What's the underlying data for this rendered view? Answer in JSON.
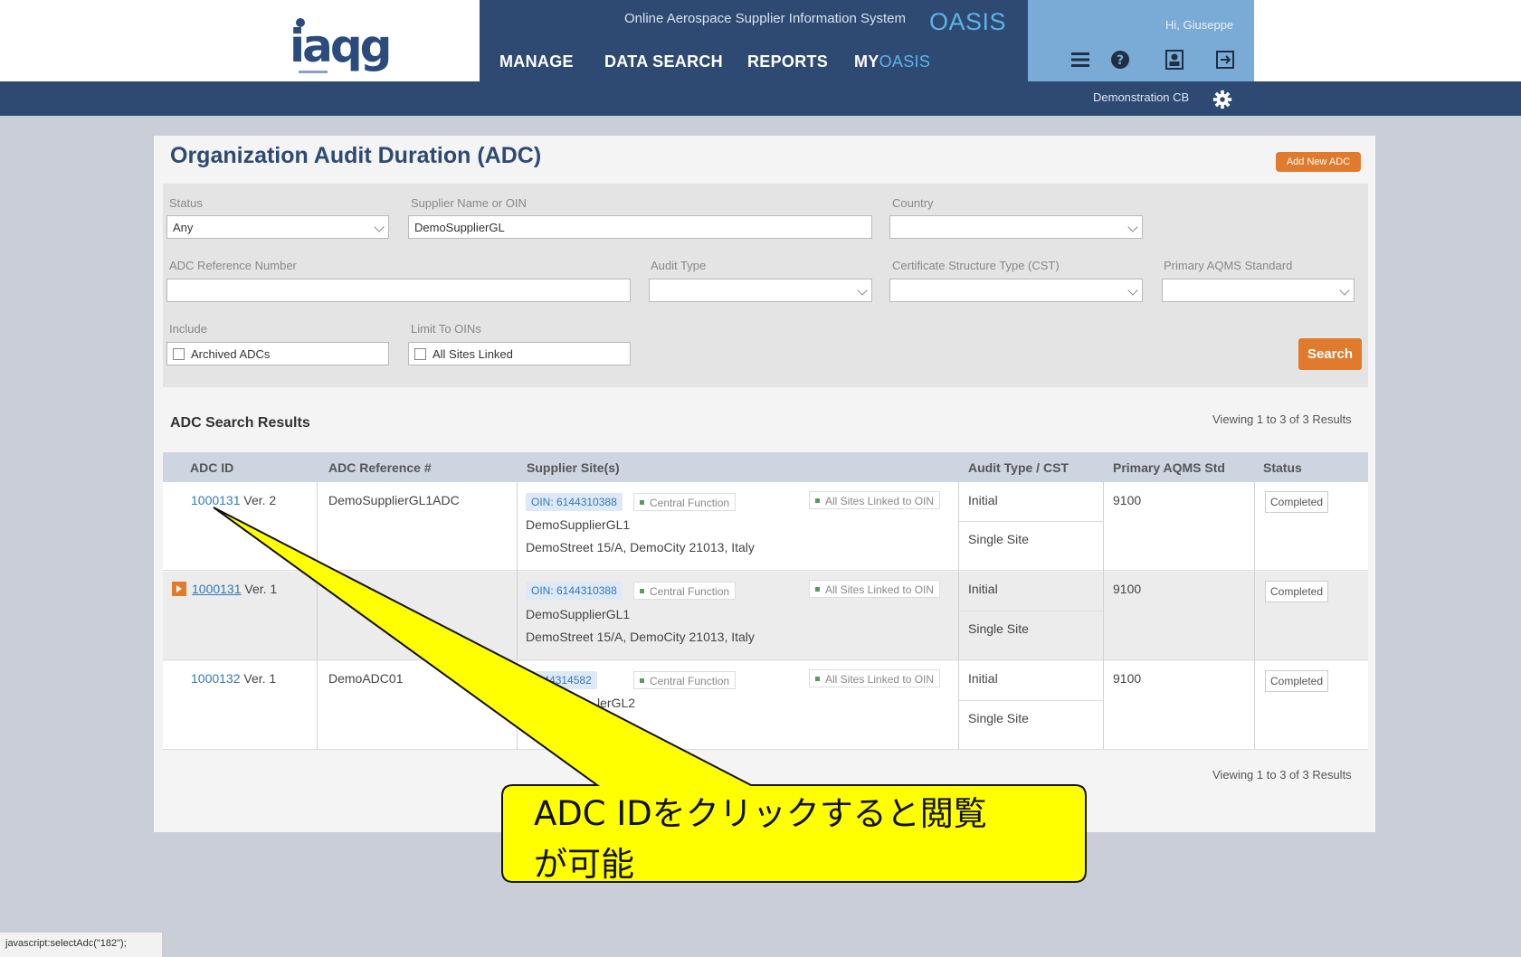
{
  "header": {
    "logo": "iaqg",
    "system_title": "Online Aerospace Supplier Information System",
    "system_name": "OASIS",
    "nav": [
      "MANAGE",
      "DATA SEARCH",
      "REPORTS"
    ],
    "nav_myoasis_prefix": "MY",
    "nav_myoasis_suffix": "OASIS",
    "greeting": "Hi, Giuseppe",
    "icons": [
      "menu-icon",
      "help-icon",
      "profile-icon",
      "logout-icon"
    ],
    "cb_label": "Demonstration CB"
  },
  "page": {
    "title": "Organization Audit Duration (ADC)",
    "add_button": "Add New ADC"
  },
  "filters": {
    "status_label": "Status",
    "status_value": "Any",
    "supplier_label": "Supplier Name or OIN",
    "supplier_value": "DemoSupplierGL",
    "country_label": "Country",
    "country_value": "",
    "ref_label": "ADC Reference Number",
    "ref_value": "",
    "audit_type_label": "Audit Type",
    "cst_label": "Certificate Structure Type (CST)",
    "aqms_label": "Primary AQMS Standard",
    "include_label": "Include",
    "include_option": "Archived ADCs",
    "limit_label": "Limit To OINs",
    "limit_option": "All Sites Linked",
    "search_button": "Search"
  },
  "results": {
    "title": "ADC Search Results",
    "viewing": "Viewing 1 to 3 of 3 Results",
    "columns": [
      "ADC ID",
      "ADC Reference #",
      "Supplier Site(s)",
      "Audit Type / CST",
      "Primary AQMS Std",
      "Status"
    ],
    "rows": [
      {
        "id": "1000131",
        "ver": "Ver. 2",
        "ref": "DemoSupplierGL1ADC",
        "oin": "OIN: 6144310388",
        "cf": "Central Function",
        "all": "All Sites Linked to OIN",
        "site_name": "DemoSupplierGL1",
        "site_addr": "DemoStreet 15/A, DemoCity 21013, Italy",
        "audit_type": "Initial",
        "cst": "Single Site",
        "aqms": "9100",
        "status": "Completed"
      },
      {
        "id": "1000131",
        "ver": "Ver. 1",
        "ref": "",
        "oin": "OIN: 6144310388",
        "cf": "Central Function",
        "all": "All Sites Linked to OIN",
        "site_name": "DemoSupplierGL1",
        "site_addr": "DemoStreet 15/A, DemoCity 21013, Italy",
        "audit_type": "Initial",
        "cst": "Single Site",
        "aqms": "9100",
        "status": "Completed"
      },
      {
        "id": "1000132",
        "ver": "Ver. 1",
        "ref": "DemoADC01",
        "oin": "6144314582",
        "cf": "Central Function",
        "all": "All Sites Linked to OIN",
        "site_name": "lerGL2",
        "site_addr": "",
        "audit_type": "Initial",
        "cst": "Single Site",
        "aqms": "9100",
        "status": "Completed"
      }
    ]
  },
  "callout": {
    "line1": "ADC IDをクリックすると閲覧",
    "line2": "が可能",
    "fill": "#ffff00"
  },
  "statusbar": "javascript:selectAdc(\"182\");"
}
